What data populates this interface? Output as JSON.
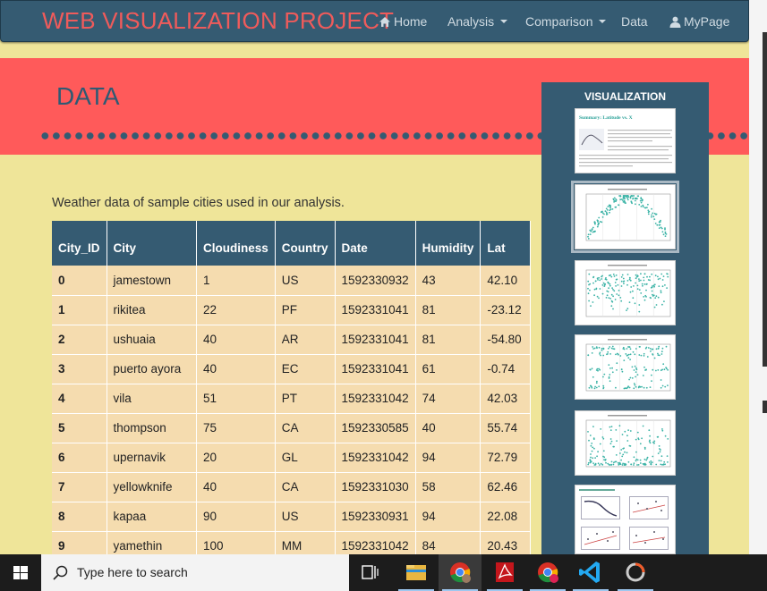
{
  "navbar": {
    "brand": "WEB VISUALIZATION PROJECT",
    "home": "Home",
    "analysis": "Analysis",
    "comparison": "Comparison",
    "data": "Data",
    "mypage": "MyPage"
  },
  "hero": {
    "title": "DATA"
  },
  "intro": "Weather data of sample cities used in our analysis.",
  "table": {
    "headers": [
      "City_ID",
      "City",
      "Cloudiness",
      "Country",
      "Date",
      "Humidity",
      "Lat"
    ],
    "rows": [
      [
        "0",
        "jamestown",
        "1",
        "US",
        "1592330932",
        "43",
        "42.10"
      ],
      [
        "1",
        "rikitea",
        "22",
        "PF",
        "1592331041",
        "81",
        "-23.12"
      ],
      [
        "2",
        "ushuaia",
        "40",
        "AR",
        "1592331041",
        "81",
        "-54.80"
      ],
      [
        "3",
        "puerto ayora",
        "40",
        "EC",
        "1592331041",
        "61",
        "-0.74"
      ],
      [
        "4",
        "vila",
        "51",
        "PT",
        "1592331042",
        "74",
        "42.03"
      ],
      [
        "5",
        "thompson",
        "75",
        "CA",
        "1592330585",
        "40",
        "55.74"
      ],
      [
        "6",
        "upernavik",
        "20",
        "GL",
        "1592331042",
        "94",
        "72.79"
      ],
      [
        "7",
        "yellowknife",
        "40",
        "CA",
        "1592331030",
        "58",
        "62.46"
      ],
      [
        "8",
        "kapaa",
        "90",
        "US",
        "1592330931",
        "94",
        "22.08"
      ],
      [
        "9",
        "yamethin",
        "100",
        "MM",
        "1592331042",
        "84",
        "20.43"
      ]
    ]
  },
  "sidebar": {
    "title": "VISUALIZATION",
    "thumb1_heading": "Summary: Latitude vs. X"
  },
  "taskbar": {
    "search_placeholder": "Type here to search"
  },
  "colors": {
    "navbar": "#355b72",
    "brand": "#ef5b5b",
    "hero": "#ff5a5a",
    "page_bg": "#efe599",
    "row_bg": "#f5dcaf",
    "scatter": "#3bb3a6"
  }
}
